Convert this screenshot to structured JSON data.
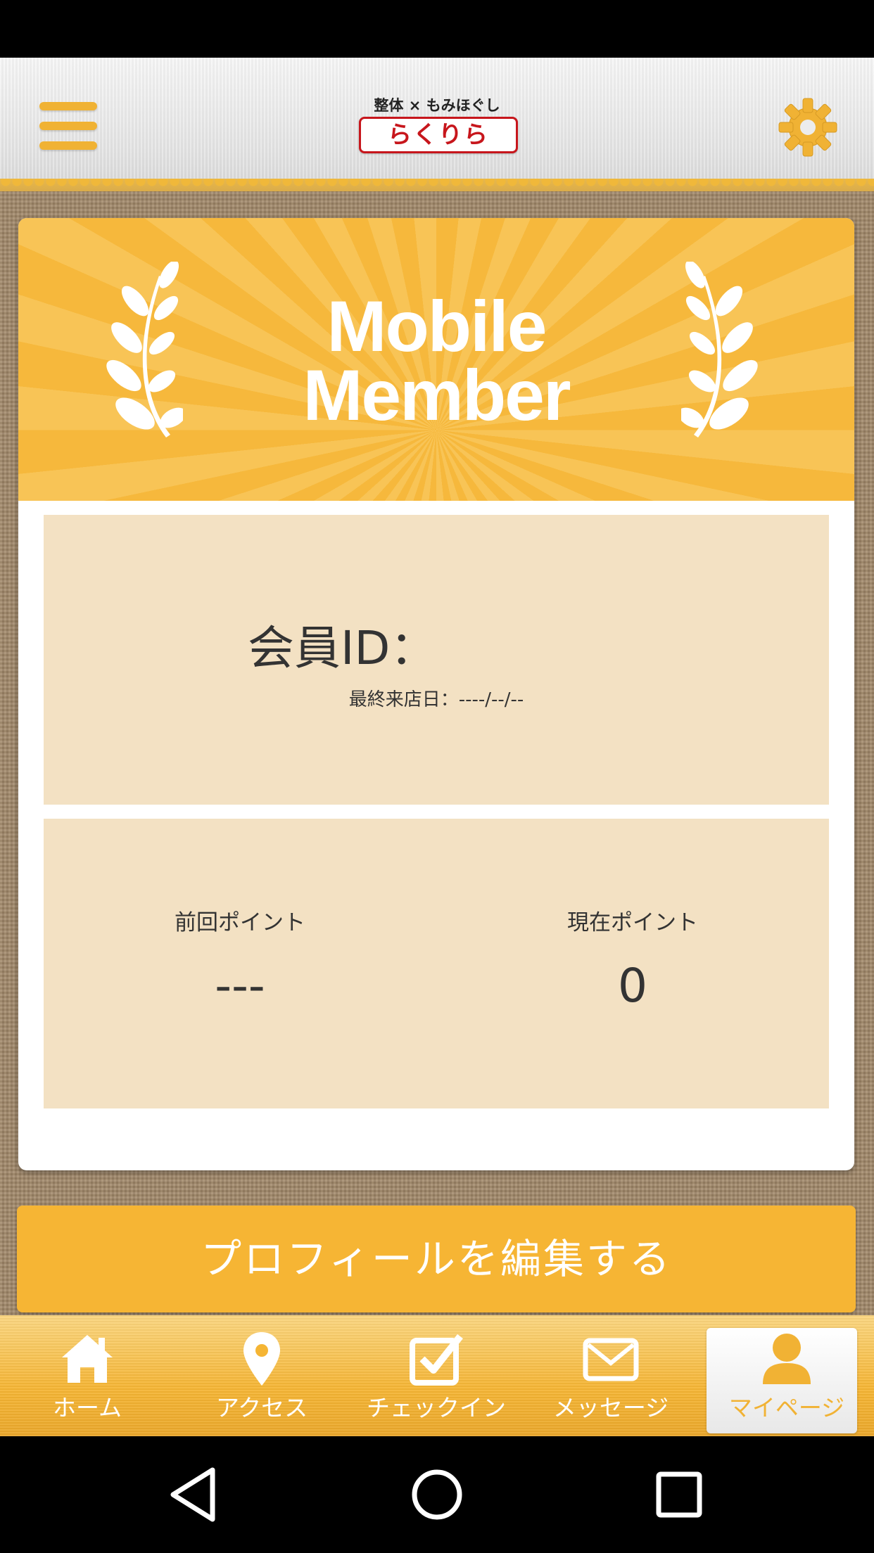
{
  "header": {
    "logo_top": "整体 × もみほぐし",
    "logo_name": "らくりら",
    "brand_color": "#c7161c",
    "accent_color": "#f0b234",
    "menu_icon": "hamburger-icon",
    "settings_icon": "gear-icon"
  },
  "member_card": {
    "banner_line1": "Mobile",
    "banner_line2": "Member",
    "banner_color": "#f6b83c",
    "member_id_label": "会員ID：",
    "last_visit": "最終来店日：----/--/--",
    "panel_color": "#f3e1c3",
    "previous_points_label": "前回ポイント",
    "previous_points_value": "---",
    "current_points_label": "現在ポイント",
    "current_points_value": "0"
  },
  "edit_profile": {
    "label": "プロフィールを編集する"
  },
  "tab_bar": {
    "items": [
      {
        "label": "ホーム",
        "icon": "home-icon"
      },
      {
        "label": "アクセス",
        "icon": "map-pin-icon"
      },
      {
        "label": "チェックイン",
        "icon": "checkbox-icon"
      },
      {
        "label": "メッセージ",
        "icon": "envelope-icon"
      },
      {
        "label": "マイページ",
        "icon": "person-icon",
        "selected": true
      }
    ]
  },
  "system_nav": {
    "back_icon": "back-triangle-icon",
    "home_icon": "home-circle-icon",
    "recents_icon": "recents-square-icon"
  }
}
